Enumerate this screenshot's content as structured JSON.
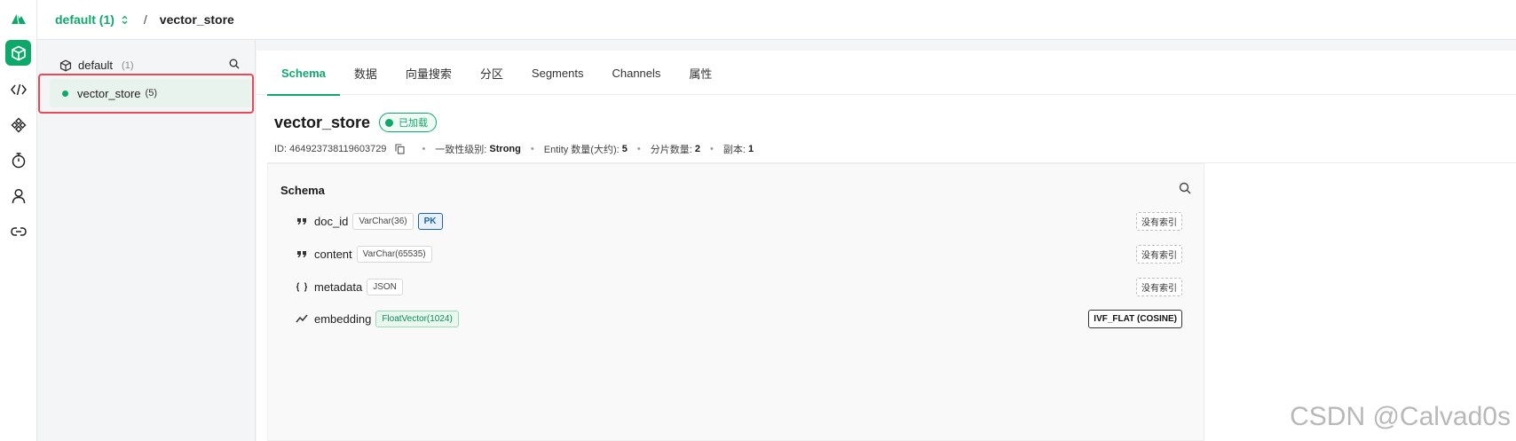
{
  "breadcrumb": {
    "database": "default (1)",
    "separator": "/",
    "collection": "vector_store"
  },
  "rail": {
    "items": [
      {
        "icon": "database-cube-icon",
        "active": true
      },
      {
        "icon": "code-icon",
        "active": false
      },
      {
        "icon": "plugin-icon",
        "active": false
      },
      {
        "icon": "stopwatch-icon",
        "active": false
      },
      {
        "icon": "user-icon",
        "active": false
      },
      {
        "icon": "link-icon",
        "active": false
      }
    ]
  },
  "tree": {
    "database": {
      "name": "default",
      "count": "(1)"
    },
    "collections": [
      {
        "name": "vector_store",
        "count": "(5)",
        "status_color": "#0fa86b"
      }
    ]
  },
  "tabs": [
    {
      "label": "Schema",
      "active": true
    },
    {
      "label": "数据",
      "active": false
    },
    {
      "label": "向量搜索",
      "active": false
    },
    {
      "label": "分区",
      "active": false
    },
    {
      "label": "Segments",
      "active": false
    },
    {
      "label": "Channels",
      "active": false
    },
    {
      "label": "属性",
      "active": false
    }
  ],
  "collection": {
    "name": "vector_store",
    "status": "已加载",
    "id_label": "ID:",
    "id_value": "464923738119603729",
    "consistency_label": "一致性级别:",
    "consistency_value": "Strong",
    "entity_label": "Entity 数量(大约):",
    "entity_value": "5",
    "shards_label": "分片数量:",
    "shards_value": "2",
    "replicas_label": "副本:",
    "replicas_value": "1"
  },
  "schema": {
    "title": "Schema",
    "fields": [
      {
        "icon": "quote-icon",
        "name": "doc_id",
        "type": "VarChar(36)",
        "pk": "PK",
        "index": "没有索引"
      },
      {
        "icon": "quote-icon",
        "name": "content",
        "type": "VarChar(65535)",
        "index": "没有索引"
      },
      {
        "icon": "json-braces-icon",
        "name": "metadata",
        "type": "JSON",
        "index": "没有索引"
      },
      {
        "icon": "vector-trend-icon",
        "name": "embedding",
        "type": "FloatVector(1024)",
        "index": "IVF_FLAT (COSINE)"
      }
    ]
  },
  "colors": {
    "accent": "#0fa86b",
    "highlight_box": "#e8495a",
    "pk_blue": "#1d64a6"
  },
  "watermark": "CSDN @Calvad0s"
}
